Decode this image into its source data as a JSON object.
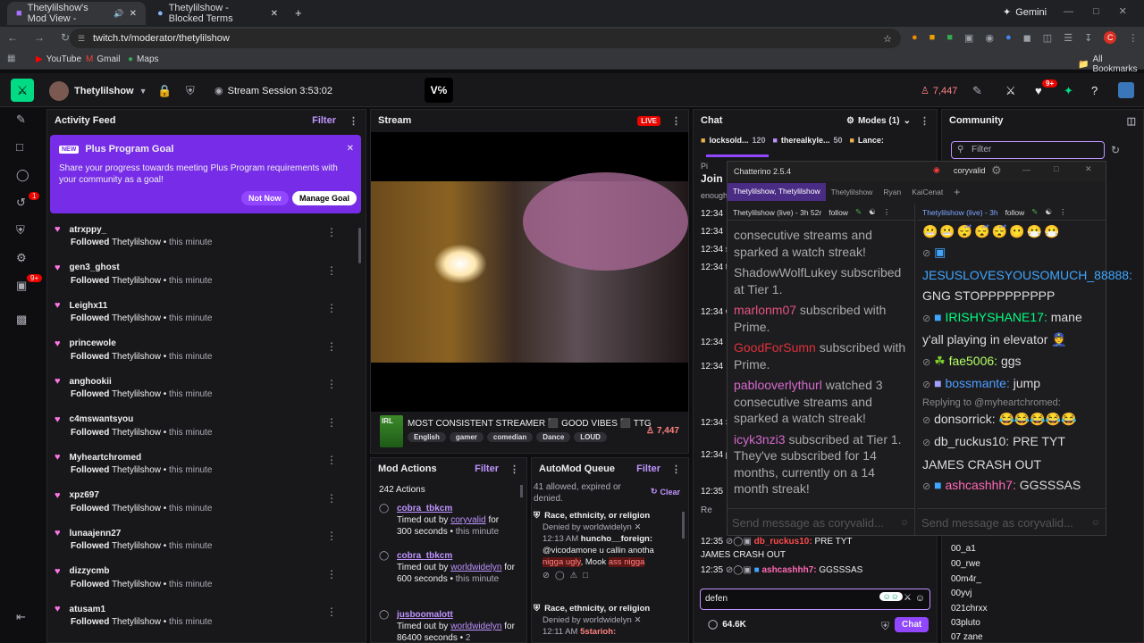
{
  "browser": {
    "tabs": [
      {
        "label": "Thetylilshow's Mod View -"
      },
      {
        "label": "Thetylilshow - Blocked Terms"
      }
    ],
    "url": "twitch.tv/moderator/thetylilshow",
    "profile_app": "Gemini",
    "profile_initial": "C",
    "bookmarks": [
      "YouTube",
      "Gmail",
      "Maps"
    ],
    "all_bookmarks": "All Bookmarks"
  },
  "topnav": {
    "channel": "Thetylilshow",
    "session": "Stream Session 3:53:02",
    "viewers": "7,447",
    "notif_badge": "9+"
  },
  "leftrail": {
    "badge_1": "1",
    "badge_2": "9+"
  },
  "activity": {
    "title": "Activity Feed",
    "filter": "Filter",
    "goal": {
      "badge": "NEW",
      "title": "Plus Program Goal",
      "body": "Share your progress towards meeting Plus Program requirements with your community as a goal!",
      "not_now": "Not Now",
      "manage": "Manage Goal"
    },
    "items": [
      {
        "user": "atrxppy_",
        "action": "Followed",
        "target": "Thetylilshow",
        "time": "this minute"
      },
      {
        "user": "gen3_ghost",
        "action": "Followed",
        "target": "Thetylilshow",
        "time": "this minute"
      },
      {
        "user": "Leighx11",
        "action": "Followed",
        "target": "Thetylilshow",
        "time": "this minute"
      },
      {
        "user": "princewole",
        "action": "Followed",
        "target": "Thetylilshow",
        "time": "this minute"
      },
      {
        "user": "anghookii",
        "action": "Followed",
        "target": "Thetylilshow",
        "time": "this minute"
      },
      {
        "user": "c4mswantsyou",
        "action": "Followed",
        "target": "Thetylilshow",
        "time": "this minute"
      },
      {
        "user": "Myheartchromed",
        "action": "Followed",
        "target": "Thetylilshow",
        "time": "this minute"
      },
      {
        "user": "xpz697",
        "action": "Followed",
        "target": "Thetylilshow",
        "time": "this minute"
      },
      {
        "user": "lunaajenn27",
        "action": "Followed",
        "target": "Thetylilshow",
        "time": "this minute"
      },
      {
        "user": "dizzycmb",
        "action": "Followed",
        "target": "Thetylilshow",
        "time": "this minute"
      },
      {
        "user": "atusam1",
        "action": "Followed",
        "target": "Thetylilshow",
        "time": "this minute"
      }
    ]
  },
  "stream": {
    "title": "Stream",
    "live": "LIVE",
    "stream_title": "MOST CONSISTENT STREAMER ⬛ GOOD VIBES ⬛ TTG",
    "viewers": "7,447",
    "tags": [
      "English",
      "gamer",
      "comedian",
      "Dance",
      "LOUD"
    ],
    "game_thumb": "IRL"
  },
  "modactions": {
    "title": "Mod Actions",
    "filter": "Filter",
    "count": "242 Actions",
    "items": [
      {
        "user": "cobra_tbkcm",
        "pre": "Timed out by",
        "by": "coryvalid",
        "dur": "for 300 seconds",
        "time": "this minute"
      },
      {
        "user": "cobra_tbkcm",
        "pre": "Timed out by",
        "by": "worldwidelyn",
        "dur": "for 600 seconds",
        "time": "this minute"
      },
      {
        "user": "jusboomalott",
        "pre": "Timed out by",
        "by": "worldwidelyn",
        "dur": "for 86400 seconds",
        "time": "2"
      }
    ]
  },
  "automod": {
    "title": "AutoMod Queue",
    "filter": "Filter",
    "status": "41 allowed, expired or denied.",
    "clear": "Clear",
    "items": [
      {
        "category": "Race, ethnicity, or religion",
        "denied": "Denied by worldwidelyn",
        "time": "12:13 AM",
        "user": "huncho__foreign:",
        "msg_a": "@vicodamone u callin anotha",
        "flag_1": "nigga ugly",
        "msg_b": ", Mook",
        "flag_2": "ass nigga"
      },
      {
        "category": "Race, ethnicity, or religion",
        "denied": "Denied by worldwidelyn",
        "time": "12:11 AM",
        "user": "5starioh:"
      }
    ]
  },
  "chat": {
    "title": "Chat",
    "modes": "Modes (1)",
    "pinned": [
      {
        "user": "locksold...",
        "count": "120"
      },
      {
        "user": "therealkyle...",
        "count": "50"
      },
      {
        "user": "Lance:",
        "count": ""
      }
    ],
    "join": "Join",
    "partial": [
      "Pi",
      "enough",
      "12:34",
      "12:34",
      "12:34 skin",
      "12:34 the ba",
      "12:34 CRAS",
      "12:34",
      "12:34",
      "12:34 STOP",
      "12:34 playin",
      "12:35",
      "Re"
    ],
    "line_1": {
      "time": "12:35",
      "user": "db_ruckus10:",
      "msg": "PRE TYT JAMES CRASH OUT"
    },
    "line_2": {
      "time": "12:35",
      "user": "ashcashhh7:",
      "msg": "GGSSSAS"
    },
    "input_value": "defen",
    "points": "64.6K",
    "chat_button": "Chat"
  },
  "community": {
    "title": "Community",
    "filter_placeholder": "Filter",
    "users": [
      "00_a1",
      "00_rwe",
      "00m4r_",
      "00yvj",
      "021chrxx",
      "03pluto",
      "07 zane"
    ]
  },
  "chatterino": {
    "version": "Chatterino 2.5.4",
    "account": "coryvalid",
    "tabs": [
      "Thetylilshow, Thetylilshow",
      "Thetylilshow",
      "Ryan",
      "KaiCenat"
    ],
    "left_header": {
      "channel": "Thetylilshow (live) - 3h 52r",
      "follow": "follow"
    },
    "right_header": {
      "channel": "Thetylilshow (live) - 3h",
      "follow": "follow"
    },
    "left_messages": [
      {
        "user": "",
        "text": "consecutive streams and sparked a watch streak!"
      },
      {
        "user": "ShadowWolfLukey",
        "text": "subscribed at Tier 1."
      },
      {
        "user": "marlonm07",
        "text": "subscribed with Prime."
      },
      {
        "user": "GoodForSumn",
        "text": "subscribed with Prime."
      },
      {
        "user": "pablooverlythurl",
        "text": "watched 3 consecutive streams and sparked a watch streak!"
      },
      {
        "user": "icyk3nzi3",
        "text": "subscribed at Tier 1. They've subscribed for 14 months, currently on a 14 month streak!"
      }
    ],
    "right_messages": [
      {
        "user": "JESUSLOVESYOUSOMUCH_88888:",
        "text": "GNG STOPPPPPPPPP",
        "color": "#3ea6ff"
      },
      {
        "user": "IRISHYSHANE17:",
        "text": "mane y'all playing in elevator",
        "color": "#00ff7f"
      },
      {
        "user": "fae5006:",
        "text": "ggs",
        "color": "#b4ff64"
      },
      {
        "user": "bossmante:",
        "text": "jump",
        "color": "#4d9fff"
      },
      {
        "reply": "Replying to @myheartchromed:",
        "user": "donsorrick:",
        "text": "",
        "color": "#dcdcdc"
      },
      {
        "user": "db_ruckus10:",
        "text": "PRE TYT JAMES CRASH OUT",
        "color": "#dcdcdc"
      },
      {
        "user": "ashcashhh7:",
        "text": "GGSSSAS",
        "color": "#ff69b4"
      }
    ],
    "input_placeholder": "Send message as coryvalid..."
  }
}
